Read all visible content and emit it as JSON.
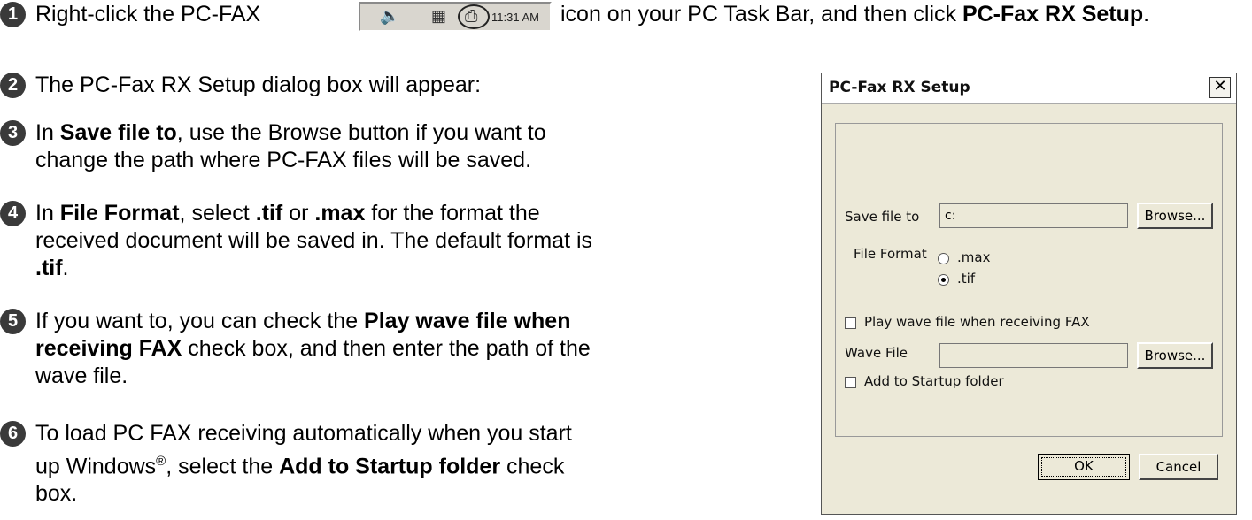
{
  "steps": [
    {
      "num": "1",
      "a": "Right-click the PC-FAX",
      "b": "icon on your PC Task Bar, and then click ",
      "c": "PC-Fax RX Setup",
      "d": "."
    },
    {
      "num": "2",
      "a": "The PC-Fax RX Setup dialog box will appear:"
    },
    {
      "num": "3",
      "a": "In ",
      "b": "Save file to",
      "c": ", use the Browse button if you want to",
      "d": "change the path where PC-FAX files will be saved."
    },
    {
      "num": "4",
      "a": "In ",
      "b": "File Format",
      "c": ", select ",
      "d": ".tif",
      "e": " or ",
      "f": ".max",
      "g": " for the format the",
      "h": "received document will be saved in. The default format is",
      "i": ".tif",
      "j": "."
    },
    {
      "num": "5",
      "a": "If you want to, you can check the ",
      "b": "Play wave file when",
      "c": "receiving FAX",
      "d": " check box, and then enter the path of the",
      "e": "wave file."
    },
    {
      "num": "6",
      "a": "To load PC FAX receiving automatically when you start",
      "b": "up Windows",
      "sup": "®",
      "c": ", select the ",
      "d": "Add to Startup folder",
      "e": " check",
      "f": "box."
    }
  ],
  "taskbar": {
    "time": "11:31 AM",
    "speaker_icon": "speaker-icon",
    "tray_icon": "tray-icon",
    "fax_icon": "pc-fax-icon"
  },
  "dialog": {
    "title": "PC-Fax RX Setup",
    "close": "✕",
    "save_file_to_label": "Save file to",
    "save_file_to_value": "c:",
    "browse1": "Browse...",
    "file_format_label": "File Format",
    "max_option": ".max",
    "tif_option": ".tif",
    "selected_format": ".tif",
    "play_wave_label": "Play wave file when receiving FAX",
    "wave_file_label": "Wave File",
    "wave_file_value": "",
    "browse2": "Browse...",
    "add_startup_label": "Add to Startup folder",
    "ok": "OK",
    "cancel": "Cancel"
  }
}
